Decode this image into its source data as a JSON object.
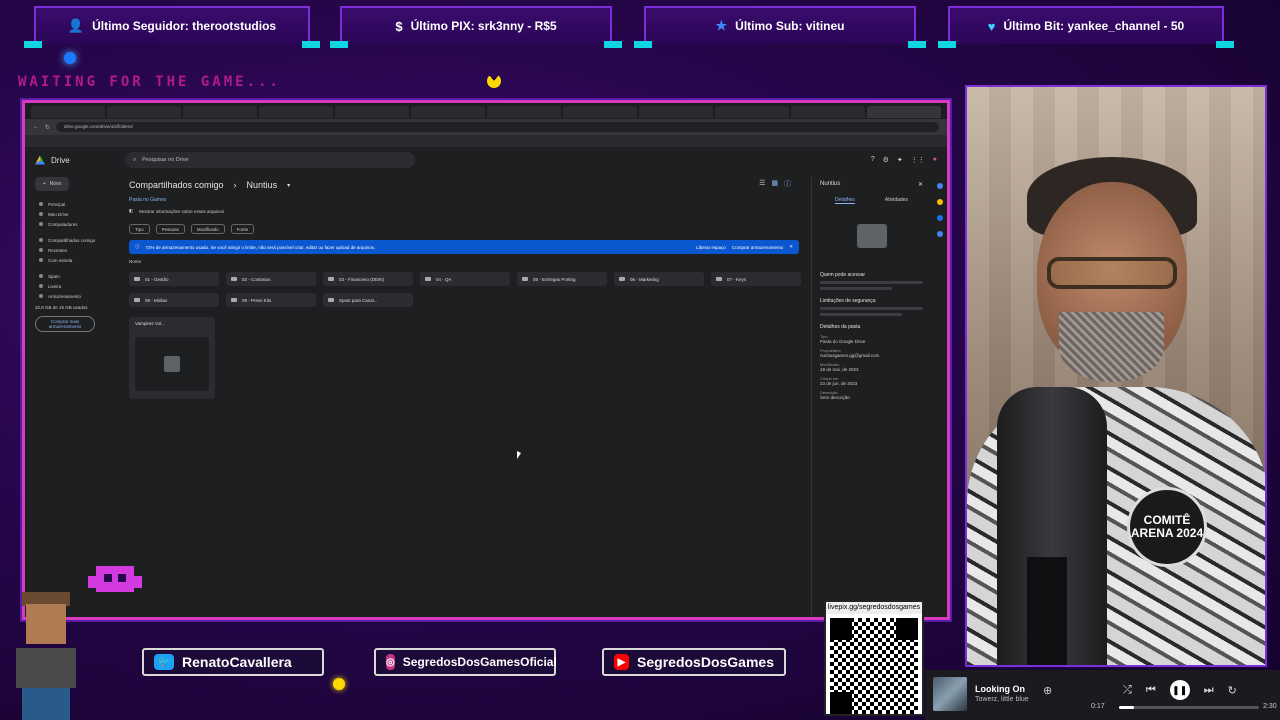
{
  "alerts": [
    {
      "icon": "user-icon",
      "text": "Último Seguidor: therootstudios"
    },
    {
      "icon": "dollar-icon",
      "text": "Último PIX: srk3nny - R$5"
    },
    {
      "icon": "star-icon",
      "text": "Último Sub: vitineu"
    },
    {
      "icon": "heart-icon",
      "text": "Último Bit: yankee_channel - 50"
    }
  ],
  "waiting_text": "WAITING FOR THE GAME...",
  "browser": {
    "url": "drive.google.com/drive/u/2/folders/",
    "drive_label": "Drive",
    "search_placeholder": "Pesquisar no Drive",
    "new_button": "Novo",
    "sidebar": [
      "Principal",
      "Meu Drive",
      "Computadores",
      "Compartilhados comigo",
      "Recentes",
      "Com estrela",
      "Spam",
      "Lixeira",
      "Armazenamento"
    ],
    "storage_text": "32,9 GB de 15 GB usados",
    "buy_storage": "Comprar mais armazenamento",
    "breadcrumb_root": "Compartilhados comigo",
    "breadcrumb_current": "Nuntius",
    "shared_by": "Pasta no Games",
    "info_text": "Mostrar informações sobre esses arquivos",
    "filters": [
      "Tipo",
      "Pessoas",
      "Modificado",
      "Fonte"
    ],
    "banner_text": "72% de armazenamento usado. Se você atingir o limite, não será possível criar, editar ou fazer upload de arquivos.",
    "banner_dismiss": "Liberar espaço",
    "banner_action": "Comprar armazenamento",
    "name_header": "Nome",
    "folders": [
      "01 - Gestão",
      "02 - Contratos",
      "03 - Financeiro (DEIN)",
      "04 - QA",
      "05 - Entregas Porting",
      "06 - Marketing",
      "07 - Keys",
      "08 - Mídias",
      "09 - Press Kits",
      "Spots para Canal..."
    ],
    "file_title": "Vampires Vol...",
    "details": {
      "title": "Nuntius",
      "tab_details": "Detalhes",
      "tab_activity": "Atividades",
      "access_label": "Quem pode acessar",
      "security_label": "Limitações de segurança",
      "folder_details": "Detalhes da pasta",
      "type_key": "Tipo",
      "type_val": "Pasta do Google Drive",
      "owner_key": "Proprietário",
      "owner_val": "nuntiusgames.gg@gmail.com",
      "modified_key": "Modificado",
      "modified_val": "18 de mai. de 2023",
      "created_key": "Criado em",
      "created_val": "23 de jun. de 2023",
      "desc_key": "Descrição",
      "desc_val": "Sem descrição"
    }
  },
  "social": [
    {
      "icon": "twitter-icon",
      "handle": "RenatoCavallera",
      "color": "#1da1f2"
    },
    {
      "icon": "instagram-icon",
      "handle": "SegredosDosGamesOficial",
      "color": "#c13584"
    },
    {
      "icon": "youtube-icon",
      "handle": "SegredosDosGames",
      "color": "#ff0000"
    }
  ],
  "qr_label": "livepix.gg/segredosdosgames",
  "badge_text": "COMITÊ ARENA 2024",
  "player": {
    "song": "Looking On",
    "artist": "Towerz, little blue",
    "current_time": "0:17",
    "total_time": "2:30",
    "progress": 0.11
  }
}
